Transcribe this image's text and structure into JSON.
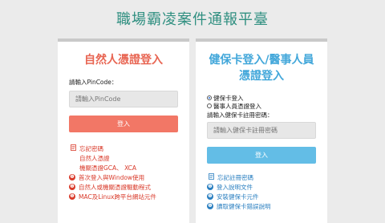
{
  "page": {
    "title": "職場霸凌案件通報平臺"
  },
  "left_card": {
    "title": "自然人憑證登入",
    "pin_label": "請輸入PinCode：",
    "pin_placeholder": "請輸入PinCode",
    "login_label": "登入",
    "links": {
      "forgot": "忘記密碼",
      "natural_cert": "自然人憑證",
      "agency_cert": "機關憑證GCA、 XCA",
      "first_time": "首次登入與Window使用",
      "driver": "自然人或機關憑證驅動程式",
      "mac_linux": "MAC及Linux跨平台網站元件"
    }
  },
  "right_card": {
    "title_line1": "健保卡登入/醫事人員",
    "title_line2": "憑證登入",
    "radio_nhi": "健保卡登入",
    "radio_medical": "醫事人員憑證登入",
    "password_label": "請輸入健保卡註冊密碼：",
    "password_placeholder": "請輸入健保卡註冊密碼",
    "login_label": "登入",
    "links": {
      "forgot": "忘記註冊密碼",
      "guide": "登入說明文件",
      "install": "安裝健保卡元件",
      "errors": "讀取健保卡錯誤說明"
    }
  }
}
